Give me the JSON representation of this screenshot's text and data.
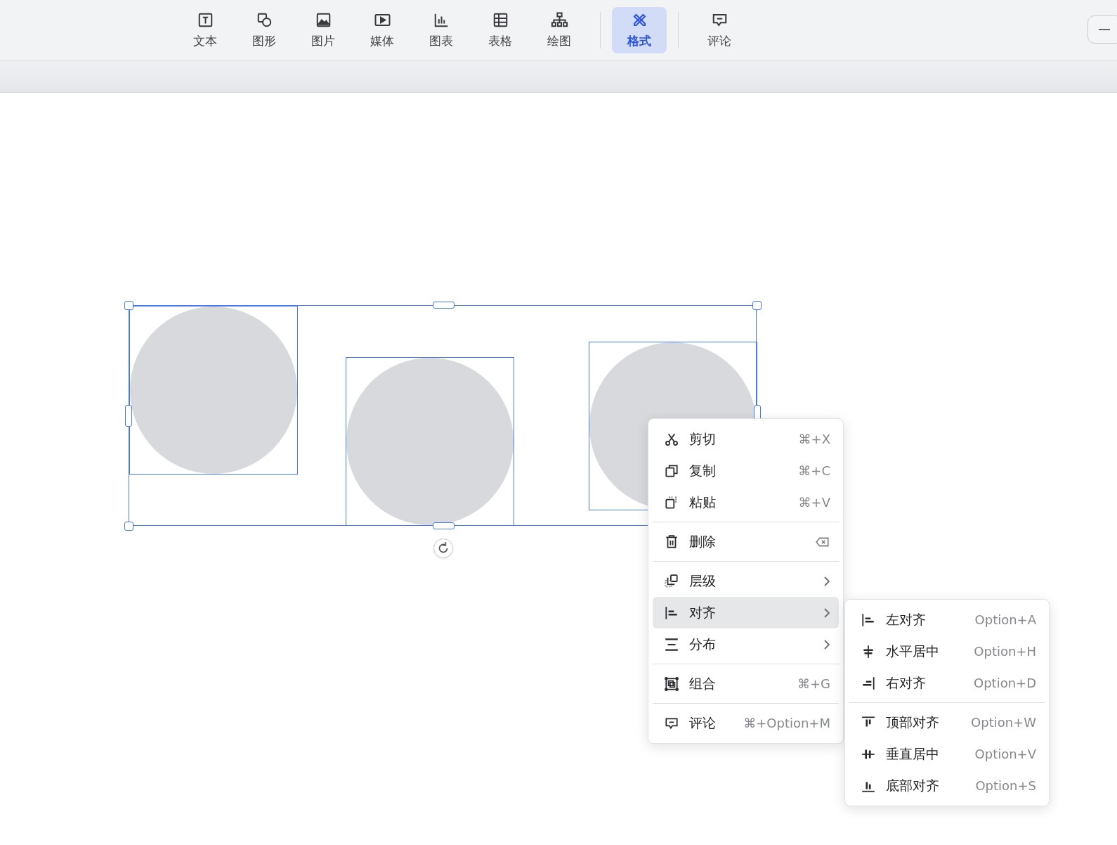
{
  "toolbar": {
    "items": [
      {
        "label": "文本",
        "selected": false
      },
      {
        "label": "图形",
        "selected": false
      },
      {
        "label": "图片",
        "selected": false
      },
      {
        "label": "媒体",
        "selected": false
      },
      {
        "label": "图表",
        "selected": false
      },
      {
        "label": "表格",
        "selected": false
      },
      {
        "label": "绘图",
        "selected": false
      },
      {
        "label": "格式",
        "selected": true
      },
      {
        "label": "评论",
        "selected": false
      }
    ]
  },
  "canvas": {
    "shapes": [
      {
        "selected": true
      },
      {
        "selected": true
      },
      {
        "selected": true
      }
    ]
  },
  "context_menu": {
    "groups": [
      [
        {
          "label": "剪切",
          "shortcut": "⌘+X",
          "highlighted": false,
          "has_submenu": false
        },
        {
          "label": "复制",
          "shortcut": "⌘+C",
          "highlighted": false,
          "has_submenu": false
        },
        {
          "label": "粘贴",
          "shortcut": "⌘+V",
          "highlighted": false,
          "has_submenu": false
        }
      ],
      [
        {
          "label": "删除",
          "highlighted": false,
          "has_submenu": false
        }
      ],
      [
        {
          "label": "层级",
          "highlighted": false,
          "has_submenu": true
        },
        {
          "label": "对齐",
          "highlighted": true,
          "has_submenu": true
        },
        {
          "label": "分布",
          "highlighted": false,
          "has_submenu": true
        }
      ],
      [
        {
          "label": "组合",
          "shortcut": "⌘+G",
          "highlighted": false,
          "has_submenu": false
        }
      ],
      [
        {
          "label": "评论",
          "shortcut": "⌘+Option+M",
          "highlighted": false,
          "has_submenu": false
        }
      ]
    ]
  },
  "submenu": {
    "groups": [
      [
        {
          "label": "左对齐",
          "shortcut": "Option+A"
        },
        {
          "label": "水平居中",
          "shortcut": "Option+H"
        },
        {
          "label": "右对齐",
          "shortcut": "Option+D"
        }
      ],
      [
        {
          "label": "顶部对齐",
          "shortcut": "Option+W"
        },
        {
          "label": "垂直居中",
          "shortcut": "Option+V"
        },
        {
          "label": "底部对齐",
          "shortcut": "Option+S"
        }
      ]
    ]
  }
}
